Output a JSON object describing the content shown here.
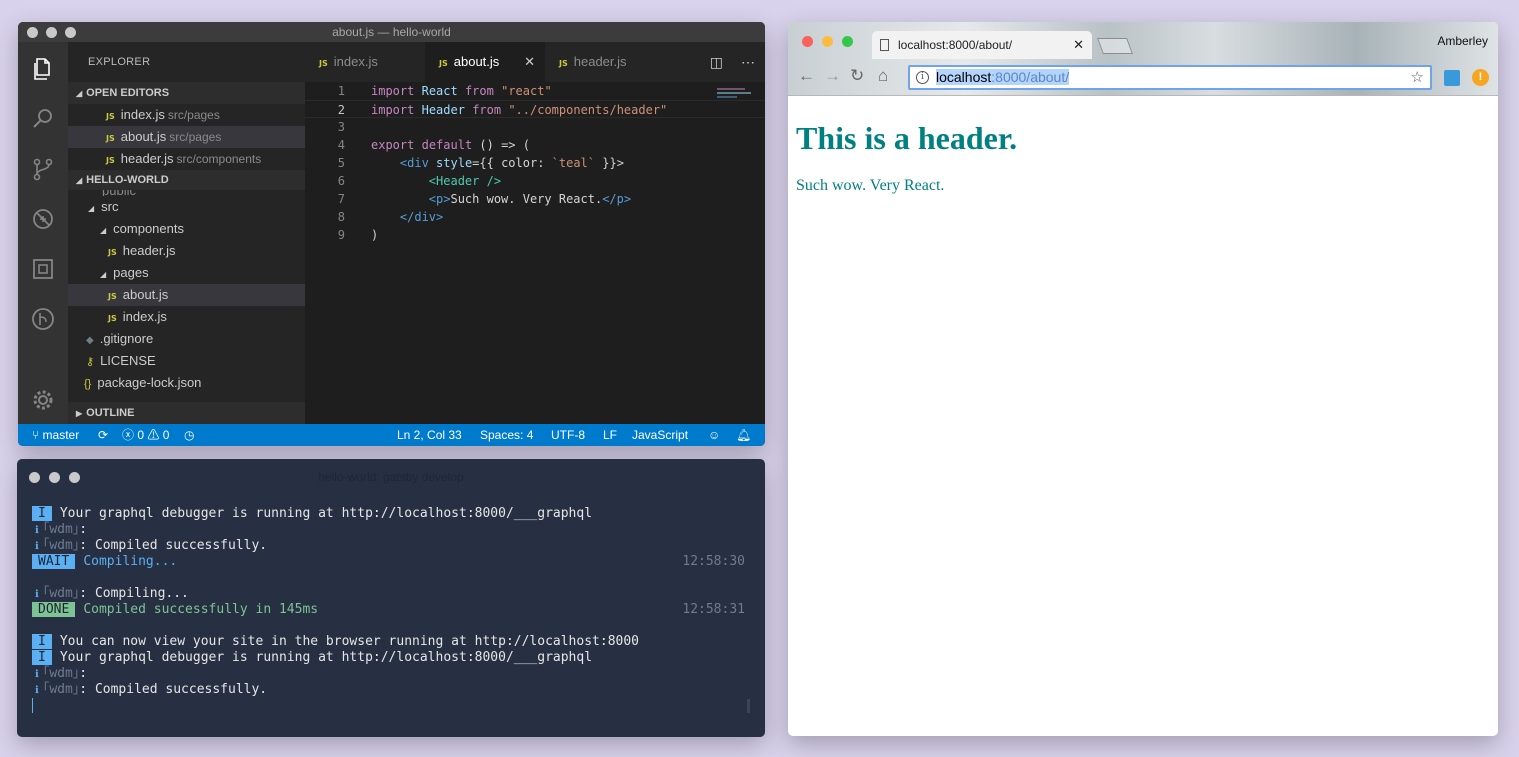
{
  "vscode": {
    "title": "about.js — hello-world",
    "explorer_label": "EXPLORER",
    "open_editors_label": "OPEN EDITORS",
    "open_editors": [
      {
        "name": "index.js",
        "path": "src/pages"
      },
      {
        "name": "about.js",
        "path": "src/pages"
      },
      {
        "name": "header.js",
        "path": "src/components"
      }
    ],
    "project_label": "HELLO-WORLD",
    "tree": {
      "public_partial": "public",
      "src": "src",
      "components": "components",
      "header": "header.js",
      "pages": "pages",
      "about": "about.js",
      "index": "index.js",
      "gitignore": ".gitignore",
      "license": "LICENSE",
      "package_lock": "package-lock.json",
      "package_partial": "package.json"
    },
    "outline_label": "OUTLINE",
    "tabs": [
      "index.js",
      "about.js",
      "header.js"
    ],
    "active_tab": "about.js",
    "js_badge": "JS",
    "code_lines": [
      "1",
      "2",
      "3",
      "4",
      "5",
      "6",
      "7",
      "8",
      "9"
    ],
    "statusbar": {
      "branch": "master",
      "errors": "0",
      "warnings": "0",
      "position": "Ln 2, Col 33",
      "spaces": "Spaces: 4",
      "encoding": "UTF-8",
      "eol": "LF",
      "language": "JavaScript"
    }
  },
  "code": {
    "import": "import",
    "from": "from",
    "react_id": "React",
    "react_str": "\"react\"",
    "header_id": "Header",
    "header_str": "\"../components/header\"",
    "export": "export",
    "default": "default",
    "arrow_open": "() => (",
    "div_open_tag": "<div",
    "style_attr": "style",
    "style_val_a": "={{ color: ",
    "style_val_str": "`teal`",
    "style_val_b": " }}>",
    "header_self": "<Header />",
    "p_open": "<p>",
    "p_text": "Such wow. Very React.",
    "p_close": "</p>",
    "div_close": "</div>",
    "paren_close": ")"
  },
  "terminal": {
    "title": "hello-world: gatsby develop",
    "badge_i": "I",
    "badge_wait": "WAIT",
    "badge_done": "DONE",
    "wdm": "｢wdm｣",
    "line1": "Your graphql debugger is running at http://localhost:8000/___graphql",
    "colon": ":",
    "compiled": ": Compiled successfully.",
    "compiling": "Compiling...",
    "compiling_wdm": ": Compiling...",
    "done_msg": "Compiled successfully in 145ms",
    "time1": "12:58:30",
    "time2": "12:58:31",
    "view_msg": "You can now view your site in the browser running at http://localhost:8000",
    "graphql_msg": "Your graphql debugger is running at http://localhost:8000/___graphql",
    "info_icon": "ℹ"
  },
  "browser": {
    "tab_title": "localhost:8000/about/",
    "profile": "Amberley",
    "url_host": "localhost",
    "url_rest": ":8000/about/",
    "page_heading": "This is a header.",
    "page_text": "Such wow. Very React.",
    "heading_color": "#008080"
  }
}
